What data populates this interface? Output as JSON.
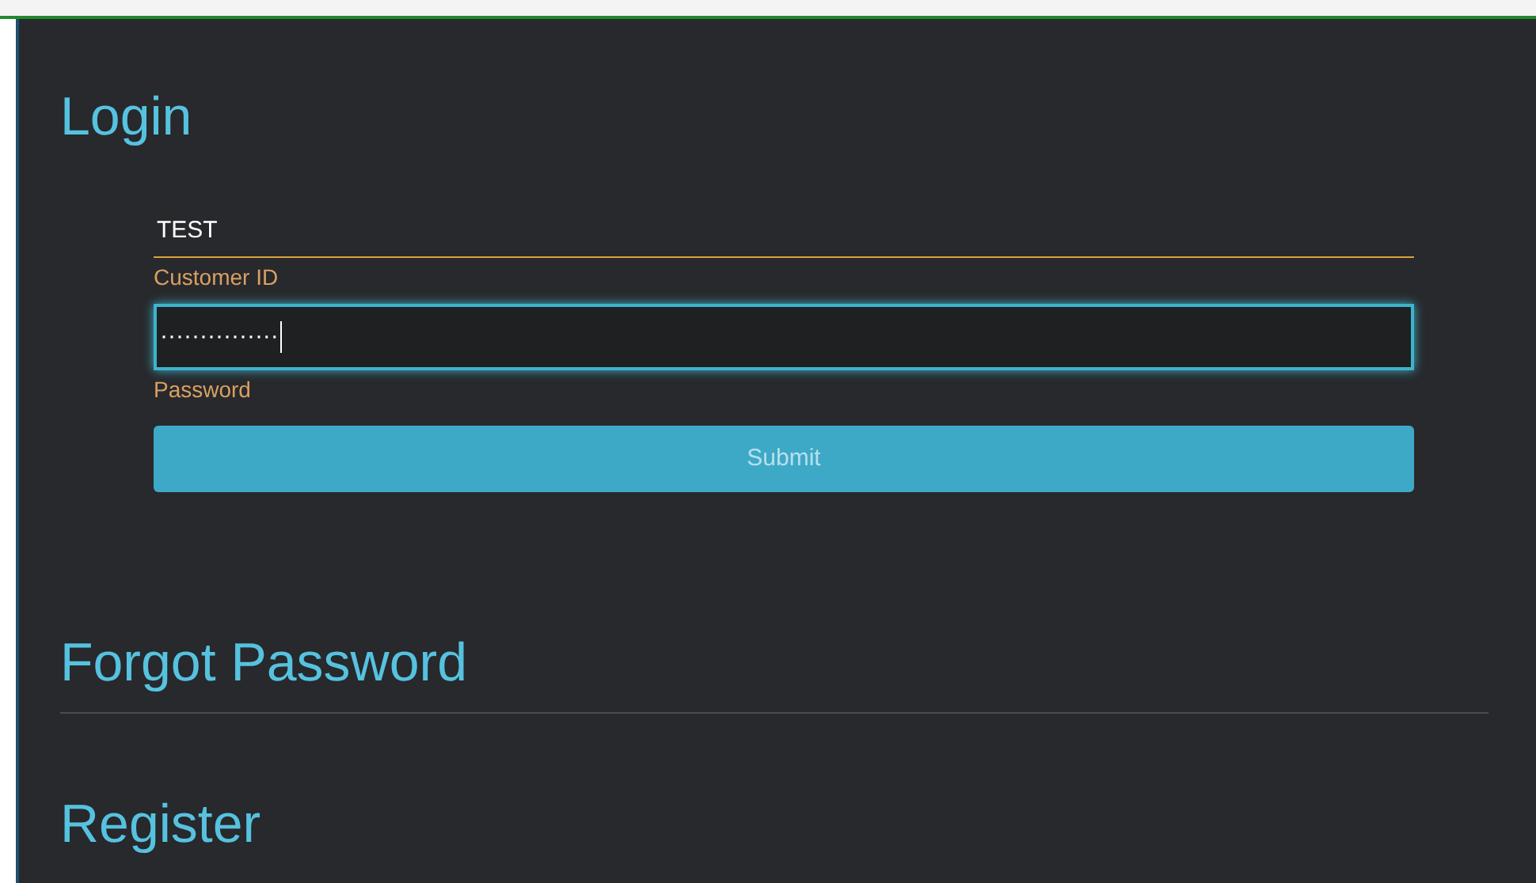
{
  "login": {
    "title": "Login",
    "fields": [
      {
        "kind": "underline",
        "value": "TEST",
        "label": "Customer ID",
        "focused": false
      },
      {
        "kind": "box",
        "value": "···············",
        "label": "Password",
        "focused": true
      }
    ],
    "submit": "Submit"
  },
  "sections": [
    {
      "title": "Forgot Password"
    },
    {
      "title": "Register"
    }
  ]
}
